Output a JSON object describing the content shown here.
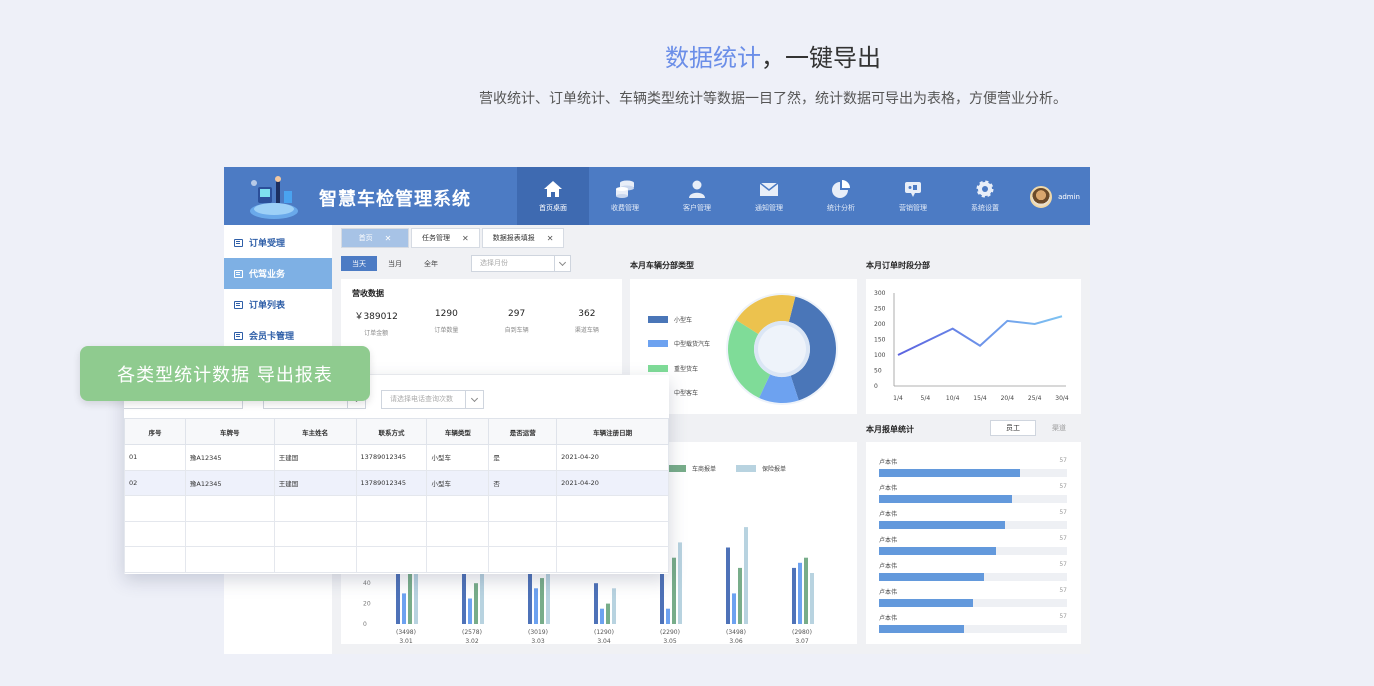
{
  "hero": {
    "title_highlight": "数据统计",
    "title_rest": "，一键导出",
    "subtitle": "营收统计、订单统计、车辆类型统计等数据一目了然，统计数据可导出为表格，方便营业分析。"
  },
  "app": {
    "title": "智慧车检管理系统",
    "user": "admin",
    "nav": [
      {
        "label": "首页桌面",
        "icon": "home-icon"
      },
      {
        "label": "收费管理",
        "icon": "coins-icon"
      },
      {
        "label": "客户管理",
        "icon": "user-icon"
      },
      {
        "label": "通知管理",
        "icon": "mail-icon"
      },
      {
        "label": "统计分析",
        "icon": "pie-icon"
      },
      {
        "label": "营销管理",
        "icon": "megaphone-icon"
      },
      {
        "label": "系统设置",
        "icon": "gear-icon"
      }
    ]
  },
  "sidebar": {
    "items": [
      {
        "label": "订单受理"
      },
      {
        "label": "代驾业务"
      },
      {
        "label": "订单列表"
      },
      {
        "label": "会员卡管理"
      }
    ]
  },
  "tabs": [
    {
      "label": "首页",
      "close": "✕"
    },
    {
      "label": "任务管理",
      "close": "✕"
    },
    {
      "label": "数据报表填报",
      "close": "✕"
    }
  ],
  "period": {
    "options": [
      "当天",
      "当月",
      "全年"
    ],
    "selected": "当天",
    "month_placeholder": "选择月份"
  },
  "revenue": {
    "title": "营收数据",
    "stats": [
      {
        "value": "￥389012",
        "label": "订单金额"
      },
      {
        "value": "1290",
        "label": "订单数量"
      },
      {
        "value": "297",
        "label": "自到车辆"
      },
      {
        "value": "362",
        "label": "渠道车辆"
      }
    ]
  },
  "vehicle_types": {
    "title": "本月车辆分部类型",
    "legend": [
      {
        "name": "小型车",
        "color": "#4a76b8"
      },
      {
        "name": "中型载货汽车",
        "color": "#6da2f0"
      },
      {
        "name": "重型货车",
        "color": "#7fdc98"
      },
      {
        "name": "中型客车",
        "color": "#ecc24e"
      }
    ]
  },
  "order_time": {
    "title": "本月订单时段分部"
  },
  "report_stats": {
    "title": "本月报单统计",
    "switch": [
      "员工",
      "渠道"
    ],
    "rows": [
      {
        "name": "卢本伟",
        "count": "57",
        "ratio": 0.75
      },
      {
        "name": "卢本伟",
        "count": "57",
        "ratio": 0.71
      },
      {
        "name": "卢本伟",
        "count": "57",
        "ratio": 0.67
      },
      {
        "name": "卢本伟",
        "count": "57",
        "ratio": 0.62
      },
      {
        "name": "卢本伟",
        "count": "57",
        "ratio": 0.56
      },
      {
        "name": "卢本伟",
        "count": "57",
        "ratio": 0.5
      },
      {
        "name": "卢本伟",
        "count": "57",
        "ratio": 0.45
      }
    ]
  },
  "chart_data": [
    {
      "type": "pie",
      "title": "本月车辆分部类型",
      "categories": [
        "小型车",
        "中型载货汽车",
        "重型货车",
        "中型客车"
      ],
      "values": [
        41,
        12,
        27,
        20
      ],
      "colors": [
        "#4a76b8",
        "#6da2f0",
        "#7fdc98",
        "#ecc24e"
      ]
    },
    {
      "type": "line",
      "title": "本月订单时段分部",
      "categories": [
        "1/4",
        "5/4",
        "10/4",
        "15/4",
        "20/4",
        "25/4",
        "30/4"
      ],
      "values": [
        100,
        185,
        130,
        210,
        200,
        225
      ],
      "x_positions": [
        "1/4",
        "10/4",
        "15/4",
        "20/4",
        "25/4",
        "30/4"
      ],
      "ylim": [
        0,
        300
      ],
      "yticks": [
        "300",
        "250",
        "200",
        "150",
        "100",
        "50",
        "0"
      ],
      "grid": false
    },
    {
      "type": "bar",
      "legend_visible": [
        "车商报单",
        "保险报单"
      ],
      "categories": [
        "3.01",
        "3.02",
        "3.03",
        "3.04",
        "3.05",
        "3.06",
        "3.07"
      ],
      "totals": [
        "(3498)",
        "(2578)",
        "(3019)",
        "(1290)",
        "(2290)",
        "(3498)",
        "(2980)"
      ],
      "yticks": [
        "40",
        "20",
        "0"
      ],
      "ylim": [
        0,
        100
      ],
      "series_colors": [
        "#4e72b8",
        "#6da2f0",
        "#78ad8a",
        "#b8d3e0"
      ],
      "series": [
        {
          "values": [
            70,
            60,
            65,
            40,
            55,
            75,
            55
          ]
        },
        {
          "values": [
            30,
            25,
            35,
            15,
            15,
            30,
            60
          ]
        },
        {
          "values": [
            60,
            40,
            45,
            20,
            65,
            55,
            65
          ]
        },
        {
          "values": [
            50,
            55,
            60,
            35,
            80,
            95,
            50
          ]
        }
      ]
    }
  ],
  "export_panel": {
    "filters": [
      "",
      "",
      "请选择电话查询次数"
    ],
    "headers": [
      "序号",
      "车牌号",
      "车主姓名",
      "联系方式",
      "车辆类型",
      "是否运营",
      "车辆注册日期"
    ],
    "rows": [
      [
        "01",
        "豫A12345",
        "王建国",
        "13789012345",
        "小型车",
        "是",
        "2021-04-20"
      ],
      [
        "02",
        "豫A12345",
        "王建国",
        "13789012345",
        "小型车",
        "否",
        "2021-04-20"
      ],
      [
        "",
        "",
        "",
        "",
        "",
        "",
        ""
      ],
      [
        "",
        "",
        "",
        "",
        "",
        "",
        ""
      ],
      [
        "",
        "",
        "",
        "",
        "",
        "",
        ""
      ]
    ]
  },
  "banner": {
    "text": "各类型统计数据  导出报表"
  }
}
